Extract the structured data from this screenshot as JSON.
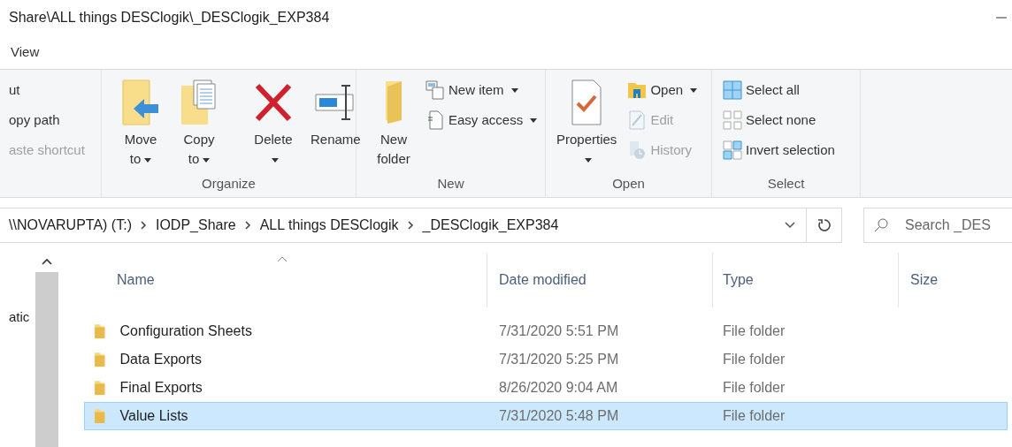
{
  "window": {
    "title": "Share\\ALL things DESClogik\\_DESClogik_EXP384"
  },
  "ribbon_tabs": [
    {
      "label": "View"
    }
  ],
  "ribbon": {
    "groups": [
      {
        "items": [
          {
            "kind": "small",
            "label": "ut",
            "dropdown": false,
            "disabled": false
          },
          {
            "kind": "small",
            "label": "opy path",
            "dropdown": false,
            "disabled": false
          },
          {
            "kind": "small",
            "label": "aste shortcut",
            "dropdown": false,
            "disabled": true
          }
        ]
      },
      {
        "label": "Organize",
        "items": [
          {
            "kind": "large",
            "lines": [
              "Move",
              "to"
            ],
            "dropdown": true,
            "disabled": false
          },
          {
            "kind": "large",
            "lines": [
              "Copy",
              "to"
            ],
            "dropdown": true,
            "disabled": false
          },
          {
            "kind": "separator"
          },
          {
            "kind": "large",
            "lines": [
              "Delete"
            ],
            "dropdown": true,
            "disabled": false
          },
          {
            "kind": "large",
            "lines": [
              "Rename"
            ],
            "dropdown": false,
            "disabled": false
          }
        ]
      },
      {
        "label": "New",
        "items": [
          {
            "kind": "large",
            "lines": [
              "New",
              "folder"
            ],
            "dropdown": false,
            "disabled": false
          },
          {
            "kind": "small",
            "label": "New item",
            "dropdown": true,
            "disabled": false
          },
          {
            "kind": "small",
            "label": "Easy access",
            "dropdown": true,
            "disabled": false
          }
        ]
      },
      {
        "label": "Open",
        "items": [
          {
            "kind": "large",
            "lines": [
              "Properties"
            ],
            "dropdown": true,
            "disabled": false
          },
          {
            "kind": "small",
            "label": "Open",
            "dropdown": true,
            "disabled": false
          },
          {
            "kind": "small",
            "label": "Edit",
            "dropdown": false,
            "disabled": true
          },
          {
            "kind": "small",
            "label": "History",
            "dropdown": false,
            "disabled": true
          }
        ]
      },
      {
        "label": "Select",
        "items": [
          {
            "kind": "small",
            "label": "Select all",
            "dropdown": false,
            "disabled": false
          },
          {
            "kind": "small",
            "label": "Select none",
            "dropdown": false,
            "disabled": false
          },
          {
            "kind": "small",
            "label": "Invert selection",
            "dropdown": false,
            "disabled": false
          }
        ]
      }
    ]
  },
  "address_bar": {
    "crumbs": [
      "\\\\NOVARUPTA) (T:)",
      "IODP_Share",
      "ALL things DESClogik",
      "_DESClogik_EXP384"
    ]
  },
  "search": {
    "placeholder": "Search _DES"
  },
  "nav_pane": {
    "items": [
      {
        "label": "atic"
      }
    ]
  },
  "file_list": {
    "columns": [
      "Name",
      "Date modified",
      "Type",
      "Size"
    ],
    "rows": [
      {
        "name": "Configuration Sheets",
        "date": "7/31/2020 5:51 PM",
        "type": "File folder",
        "selected": false
      },
      {
        "name": "Data Exports",
        "date": "7/31/2020 5:25 PM",
        "type": "File folder",
        "selected": false
      },
      {
        "name": "Final Exports",
        "date": "8/26/2020 9:04 AM",
        "type": "File folder",
        "selected": false
      },
      {
        "name": "Value Lists",
        "date": "7/31/2020 5:48 PM",
        "type": "File folder",
        "selected": true
      }
    ]
  }
}
